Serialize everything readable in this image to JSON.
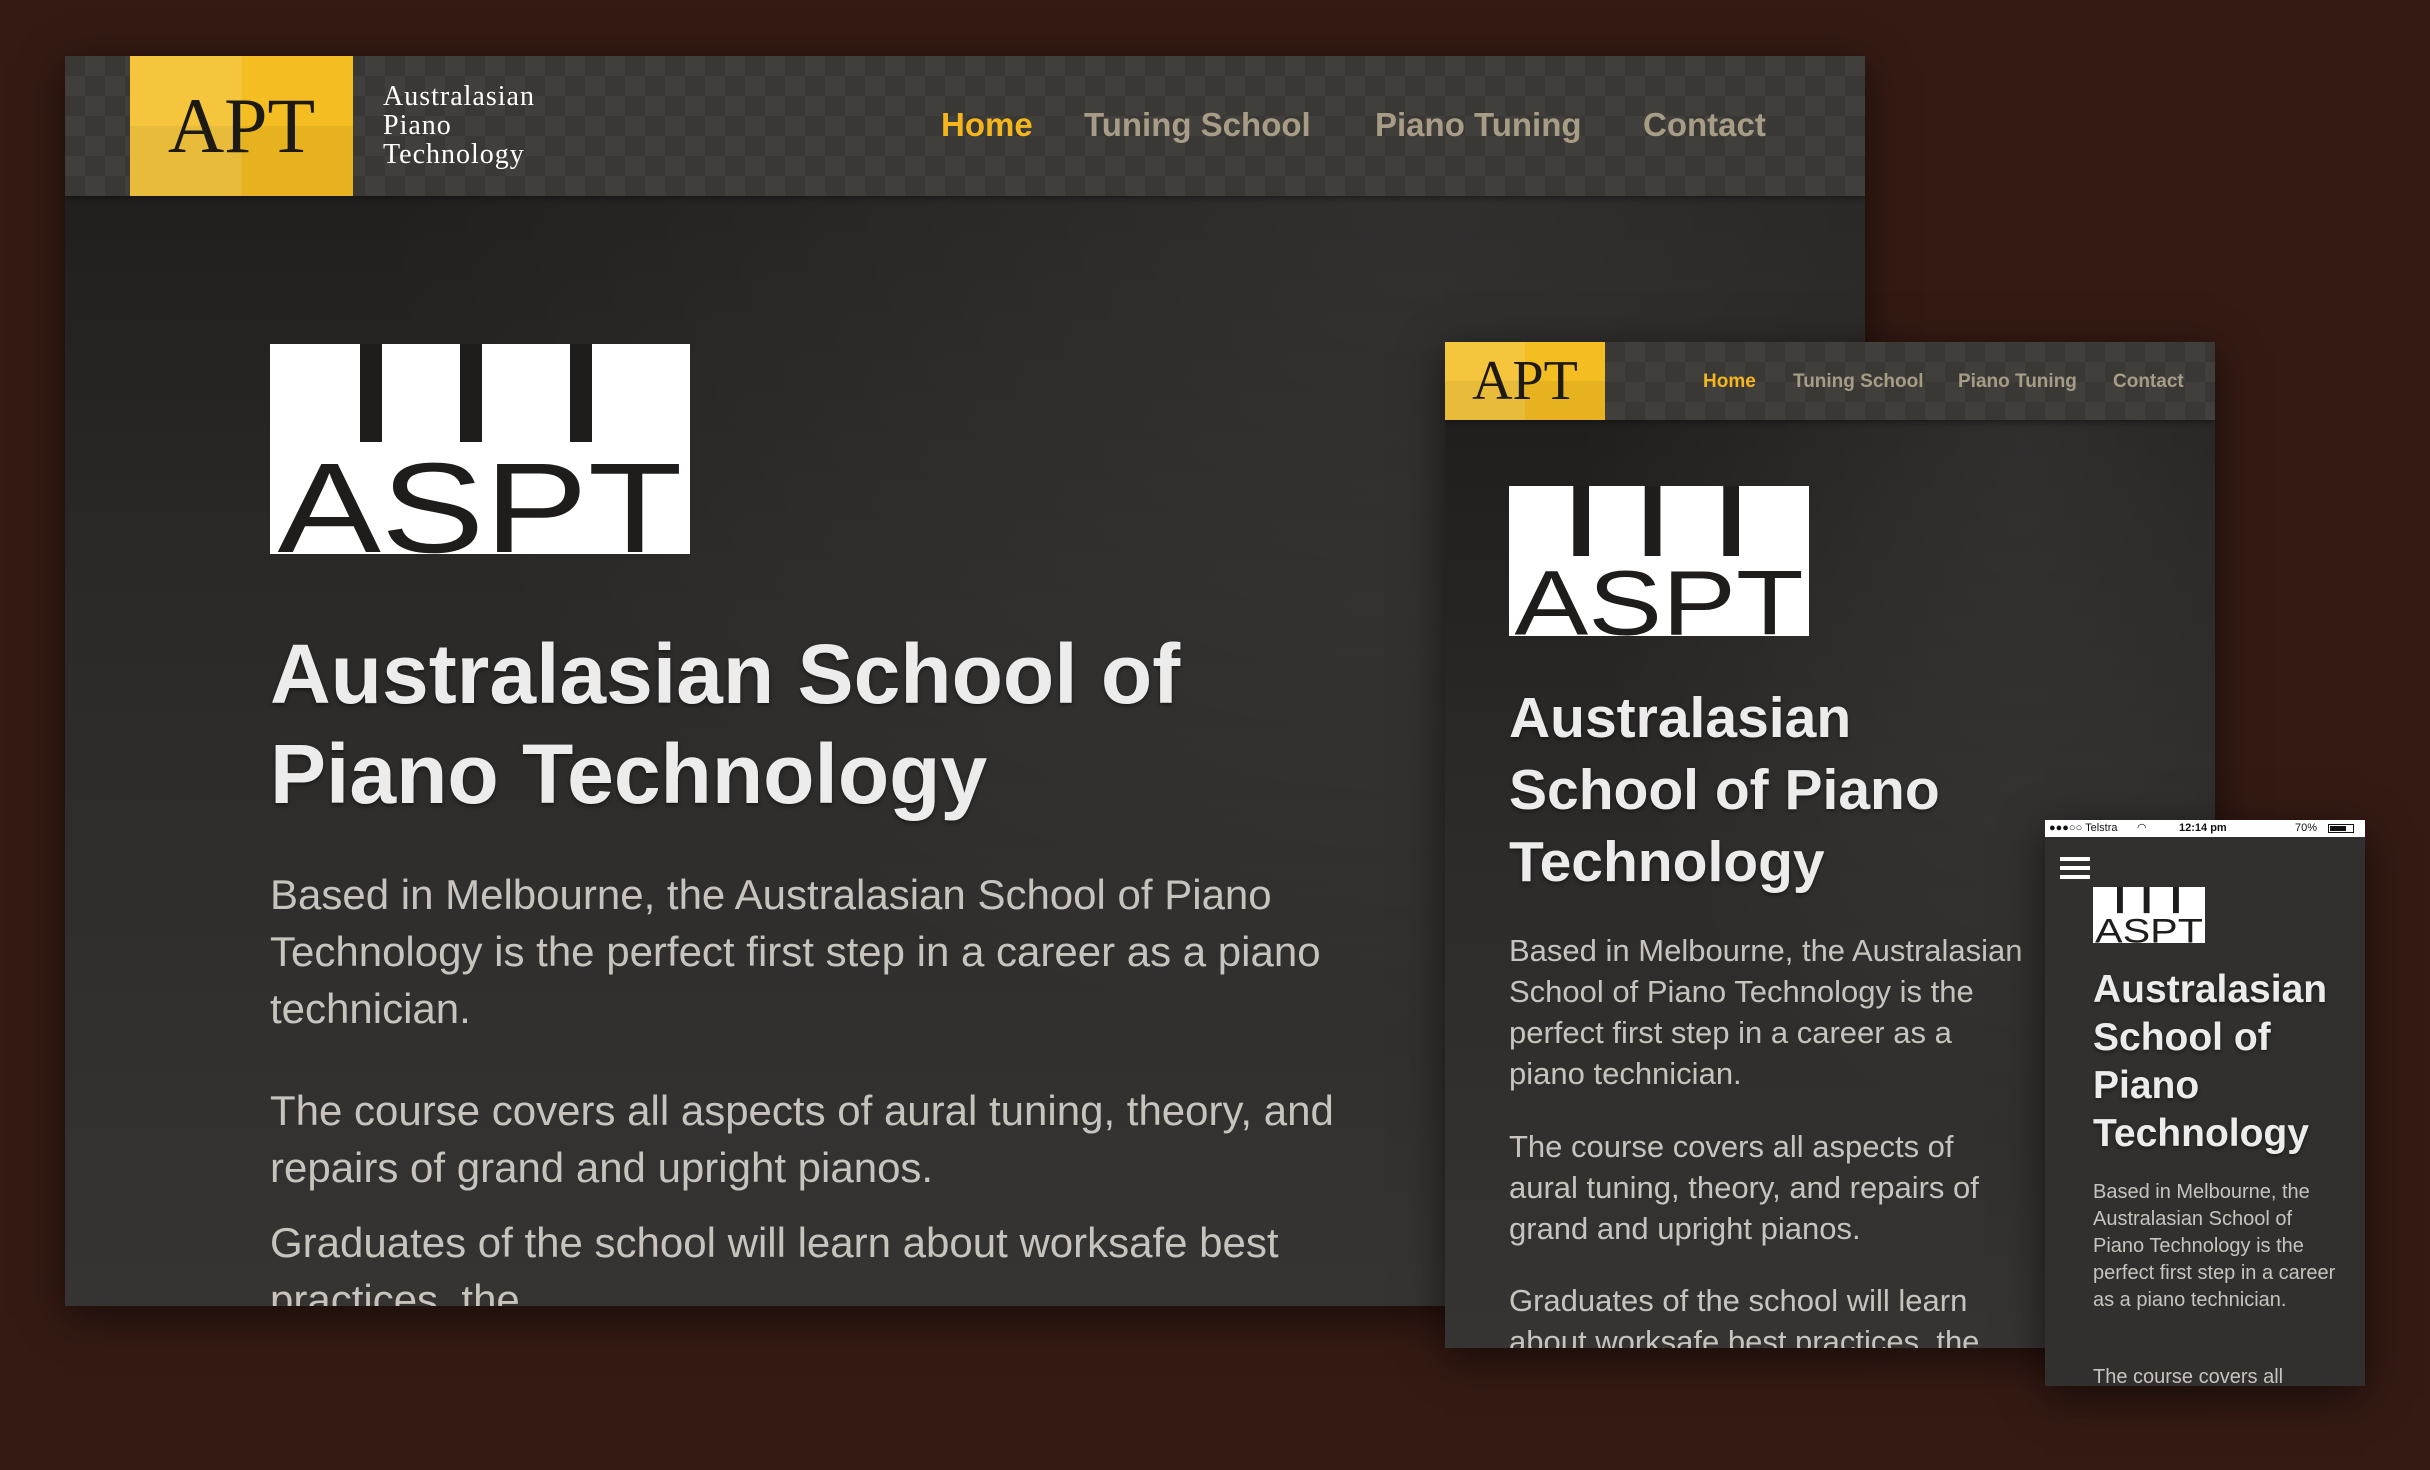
{
  "site": {
    "logo_abbr": "APT",
    "logo_name_lines": [
      "Australasian",
      "Piano",
      "Technology"
    ],
    "nav": [
      {
        "label": "Home",
        "active": true
      },
      {
        "label": "Tuning School",
        "active": false
      },
      {
        "label": "Piano Tuning",
        "active": false
      },
      {
        "label": "Contact",
        "active": false
      }
    ],
    "school_logo_text": "ASPT",
    "title": "Australasian School of Piano Technology",
    "paragraphs": [
      "Based in Melbourne, the Australasian School of Piano Technology is the perfect first step in a career as a piano technician.",
      "The course covers all aspects of aural tuning, theory, and repairs of grand and upright pianos.",
      "Graduates of the school will learn about worksafe best practices, the"
    ]
  },
  "mobile_status": {
    "carrier": "●●●○○ Telstra",
    "time": "12:14 pm",
    "battery": "70%"
  },
  "colors": {
    "background": "#351a13",
    "accent": "#f4b61c",
    "logo_yellow": "#f4bd22",
    "nav_text": "#a79d87",
    "heading": "#ececec",
    "body_text": "#c8c4bd"
  },
  "icons": {
    "menu": "hamburger-icon",
    "wifi": "wifi-icon",
    "battery": "battery-icon"
  }
}
